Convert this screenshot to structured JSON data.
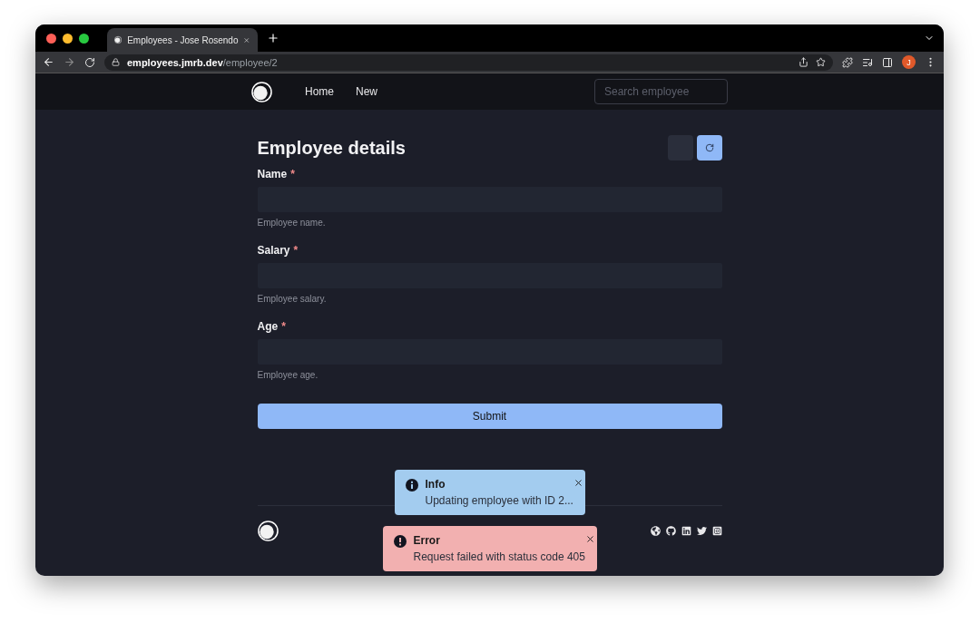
{
  "browser": {
    "tab_title": "Employees - Jose Rosendo",
    "url_host": "employees.jmrb.dev",
    "url_path": "/employee/2",
    "avatar": "J"
  },
  "navbar": {
    "links": [
      "Home",
      "New"
    ],
    "search": {
      "placeholder": "Search employee"
    }
  },
  "heading": "Employee details",
  "fields": [
    {
      "label": "Name",
      "required_mark": "*",
      "hint": "Employee name."
    },
    {
      "label": "Salary",
      "required_mark": "*",
      "hint": "Employee salary."
    },
    {
      "label": "Age",
      "required_mark": "*",
      "hint": "Employee age."
    }
  ],
  "submit": "Submit",
  "toasts": [
    {
      "kind": "info",
      "title": "Info",
      "message": "Updating employee with ID 2..."
    },
    {
      "kind": "error",
      "title": "Error",
      "message": "Request failed with status code 405"
    }
  ]
}
